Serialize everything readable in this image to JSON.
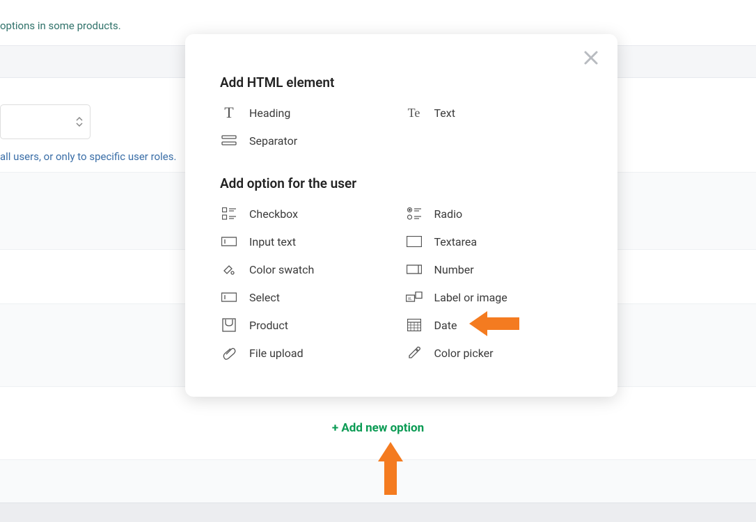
{
  "background": {
    "partial_text_top": "options in some products.",
    "partial_text_roles": "all users, or only to specific user roles.",
    "add_new_option": "+ Add new option"
  },
  "modal": {
    "section_html": "Add HTML element",
    "section_user": "Add option for the user",
    "items_html": [
      {
        "key": "heading",
        "label": "Heading"
      },
      {
        "key": "text",
        "label": "Text"
      },
      {
        "key": "separator",
        "label": "Separator"
      }
    ],
    "items_user": [
      {
        "key": "checkbox",
        "label": "Checkbox"
      },
      {
        "key": "radio",
        "label": "Radio"
      },
      {
        "key": "input-text",
        "label": "Input text"
      },
      {
        "key": "textarea",
        "label": "Textarea"
      },
      {
        "key": "color-swatch",
        "label": "Color swatch"
      },
      {
        "key": "number",
        "label": "Number"
      },
      {
        "key": "select",
        "label": "Select"
      },
      {
        "key": "label-image",
        "label": "Label or image"
      },
      {
        "key": "product",
        "label": "Product"
      },
      {
        "key": "date",
        "label": "Date"
      },
      {
        "key": "file-upload",
        "label": "File upload"
      },
      {
        "key": "color-picker",
        "label": "Color picker"
      }
    ]
  },
  "colors": {
    "accent_green": "#0b9b54",
    "arrow_orange": "#f47b20"
  }
}
